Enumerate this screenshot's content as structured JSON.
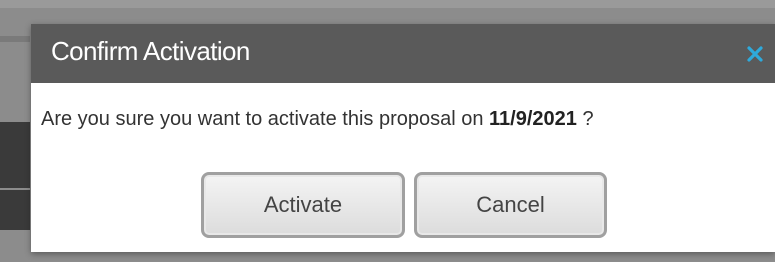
{
  "dialog": {
    "title": "Confirm Activation",
    "close_icon": "close-icon",
    "message_prefix": "Are you sure you want to activate this proposal on ",
    "message_date": "11/9/2021",
    "message_suffix": " ?",
    "buttons": {
      "activate_label": "Activate",
      "cancel_label": "Cancel"
    }
  },
  "colors": {
    "header_bg": "#5a5a5a",
    "close_icon": "#2eaadc",
    "backdrop": "#8c8c8c"
  }
}
